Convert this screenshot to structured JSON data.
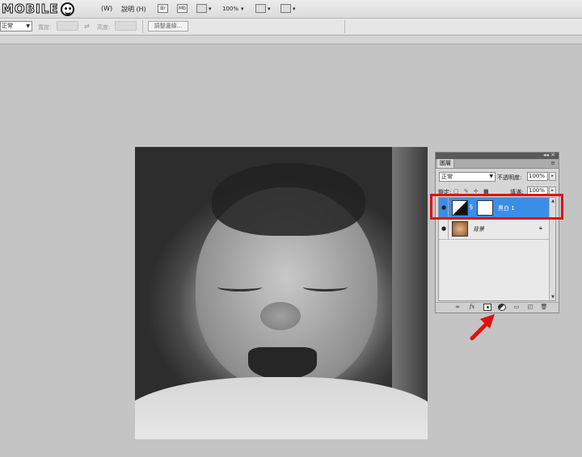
{
  "watermark": {
    "text": "MOBILE"
  },
  "menubar": {
    "items": [
      {
        "label": "(W)"
      },
      {
        "label": "說明 (H)"
      }
    ],
    "toolbar": {
      "bridge_label": "Br",
      "minibridge_label": "Mb",
      "zoom_label": "100%"
    }
  },
  "options_bar": {
    "mode_value": "正常",
    "width_label": "寬度:",
    "height_label": "高度:",
    "refine_label": "調整邊緣..."
  },
  "layers_panel": {
    "tab_label": "圖層",
    "blend_mode": "正常",
    "opacity_label": "不透明度:",
    "opacity_value": "100%",
    "lock_label": "鎖定:",
    "fill_label": "填滿:",
    "fill_value": "100%",
    "layers": [
      {
        "name": "黑白 1",
        "type": "adjustment",
        "selected": true
      },
      {
        "name": "背景",
        "type": "background",
        "locked": true
      }
    ],
    "bottom_icons": [
      "link-icon",
      "fx-icon",
      "add-mask-icon",
      "new-adjustment-layer-icon",
      "group-folder-icon",
      "new-layer-icon",
      "trash-icon"
    ]
  },
  "annotations": {
    "highlight_color": "#e01010"
  }
}
